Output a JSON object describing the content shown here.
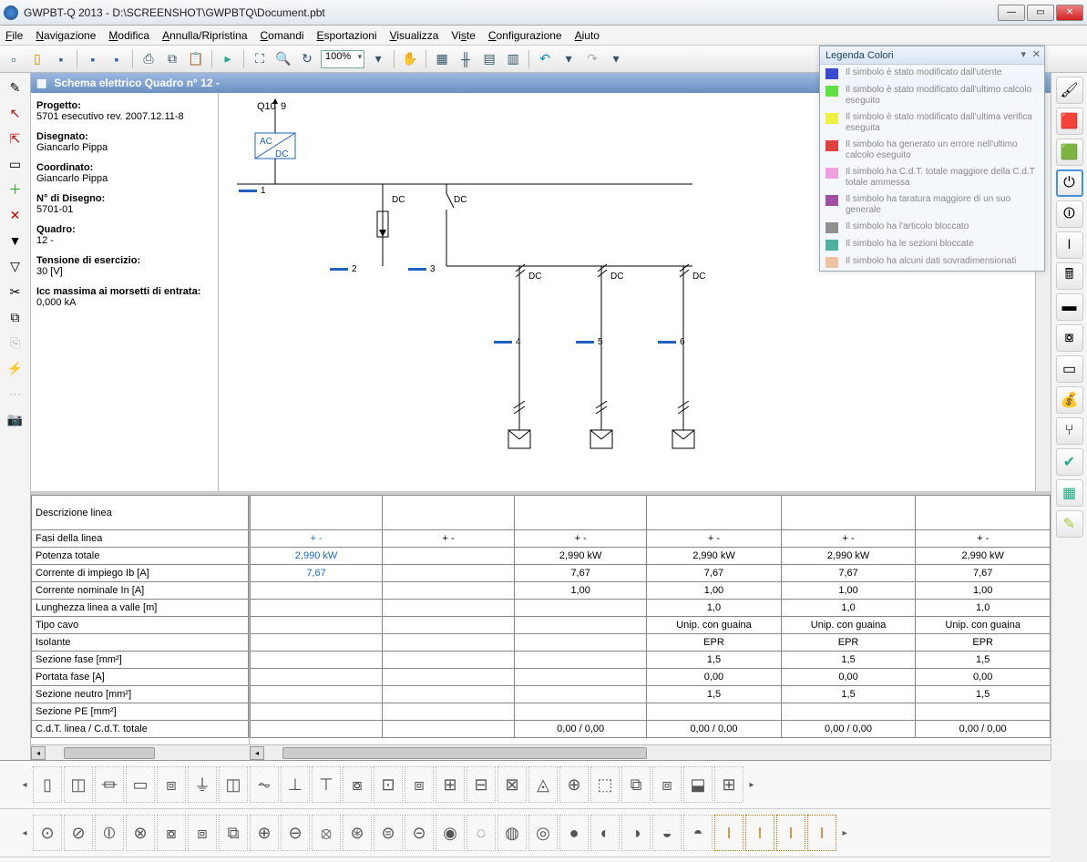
{
  "window": {
    "title": "GWPBT-Q 2013 - D:\\SCREENSHOT\\GWPBTQ\\Document.pbt"
  },
  "menu": [
    "File",
    "Navigazione",
    "Modifica",
    "Annulla/Ripristina",
    "Comandi",
    "Esportazioni",
    "Visualizza",
    "Viste",
    "Configurazione",
    "Aiuto"
  ],
  "toolbar": {
    "zoom": "100%"
  },
  "document": {
    "header": "Schema elettrico Quadro n° 12 -"
  },
  "project": {
    "progetto_l": "Progetto:",
    "progetto_v": "5701 esecutivo rev. 2007.12.11-8",
    "disegnato_l": "Disegnato:",
    "disegnato_v": "Giancarlo Pippa",
    "coordinato_l": "Coordinato:",
    "coordinato_v": "Giancarlo Pippa",
    "ndisegno_l": "N° di Disegno:",
    "ndisegno_v": "5701-01",
    "quadro_l": "Quadro:",
    "quadro_v": "12 -",
    "tensione_l": "Tensione di esercizio:",
    "tensione_v": "30 [V]",
    "icc_l": "Icc massima ai morsetti di entrata:",
    "icc_v": "0,000 kA"
  },
  "schematic": {
    "q10": "Q10",
    "nine": "9",
    "acdc_top": "AC",
    "acdc_bot": "DC",
    "dc": "DC"
  },
  "table": {
    "rows": [
      "Descrizione linea",
      "Fasi della linea",
      "Potenza totale",
      "Corrente di impiego Ib [A]",
      "Corrente nominale In [A]",
      "Lunghezza linea a valle [m]",
      "Tipo cavo",
      "Isolante",
      "Sezione fase [mm²]",
      "Portata fase [A]",
      "Sezione neutro [mm²]",
      "Sezione PE [mm²]",
      "C.d.T. linea / C.d.T. totale"
    ],
    "cols": [
      {
        "desc": "",
        "fasi": "+ -",
        "pot": "2,990 kW",
        "ib": "7,67",
        "in": "",
        "lun": "",
        "tipo": "",
        "iso": "",
        "sf": "",
        "pf": "",
        "sn": "",
        "spe": "",
        "cdt": "",
        "blue": true
      },
      {
        "desc": "",
        "fasi": "+ -",
        "pot": "",
        "ib": "",
        "in": "",
        "lun": "",
        "tipo": "",
        "iso": "",
        "sf": "",
        "pf": "",
        "sn": "",
        "spe": "",
        "cdt": ""
      },
      {
        "desc": "",
        "fasi": "+ -",
        "pot": "2,990 kW",
        "ib": "7,67",
        "in": "1,00",
        "lun": "",
        "tipo": "",
        "iso": "",
        "sf": "",
        "pf": "",
        "sn": "",
        "spe": "",
        "cdt": "0,00 / 0,00"
      },
      {
        "desc": "",
        "fasi": "+ -",
        "pot": "2,990 kW",
        "ib": "7,67",
        "in": "1,00",
        "lun": "1,0",
        "tipo": "Unip. con guaina",
        "iso": "EPR",
        "sf": "1,5",
        "pf": "0,00",
        "sn": "1,5",
        "spe": "",
        "cdt": "0,00 / 0,00"
      },
      {
        "desc": "",
        "fasi": "+ -",
        "pot": "2,990 kW",
        "ib": "7,67",
        "in": "1,00",
        "lun": "1,0",
        "tipo": "Unip. con guaina",
        "iso": "EPR",
        "sf": "1,5",
        "pf": "0,00",
        "sn": "1,5",
        "spe": "",
        "cdt": "0,00 / 0,00"
      },
      {
        "desc": "",
        "fasi": "+ -",
        "pot": "2,990 kW",
        "ib": "7,67",
        "in": "1,00",
        "lun": "1,0",
        "tipo": "Unip. con guaina",
        "iso": "EPR",
        "sf": "1,5",
        "pf": "0,00",
        "sn": "1,5",
        "spe": "",
        "cdt": "0,00 / 0,00"
      }
    ]
  },
  "legend": {
    "title": "Legenda Colori",
    "items": [
      {
        "c": "#3a4ad0",
        "t": "Il simbolo è stato modificato dall'utente"
      },
      {
        "c": "#60e040",
        "t": "Il simbolo è stato modificato dall'ultimo calcolo eseguito"
      },
      {
        "c": "#f0f040",
        "t": "Il simbolo è stato modificato dall'ultima verifica eseguita"
      },
      {
        "c": "#e04040",
        "t": "Il simbolo ha generato un errore nell'ultimo calcolo eseguito"
      },
      {
        "c": "#f0a0e0",
        "t": "Il simbolo ha C.d.T. totale maggiore della C.d.T totale ammessa"
      },
      {
        "c": "#a050a0",
        "t": "Il simbolo ha taratura maggiore di un suo generale"
      },
      {
        "c": "#909090",
        "t": "Il simbolo ha l'articolo bloccato"
      },
      {
        "c": "#50b0a0",
        "t": "Il simbolo ha le sezioni bloccate"
      },
      {
        "c": "#f0c0a0",
        "t": "Il simbolo ha alcuni dati sovradimensionati"
      }
    ]
  }
}
